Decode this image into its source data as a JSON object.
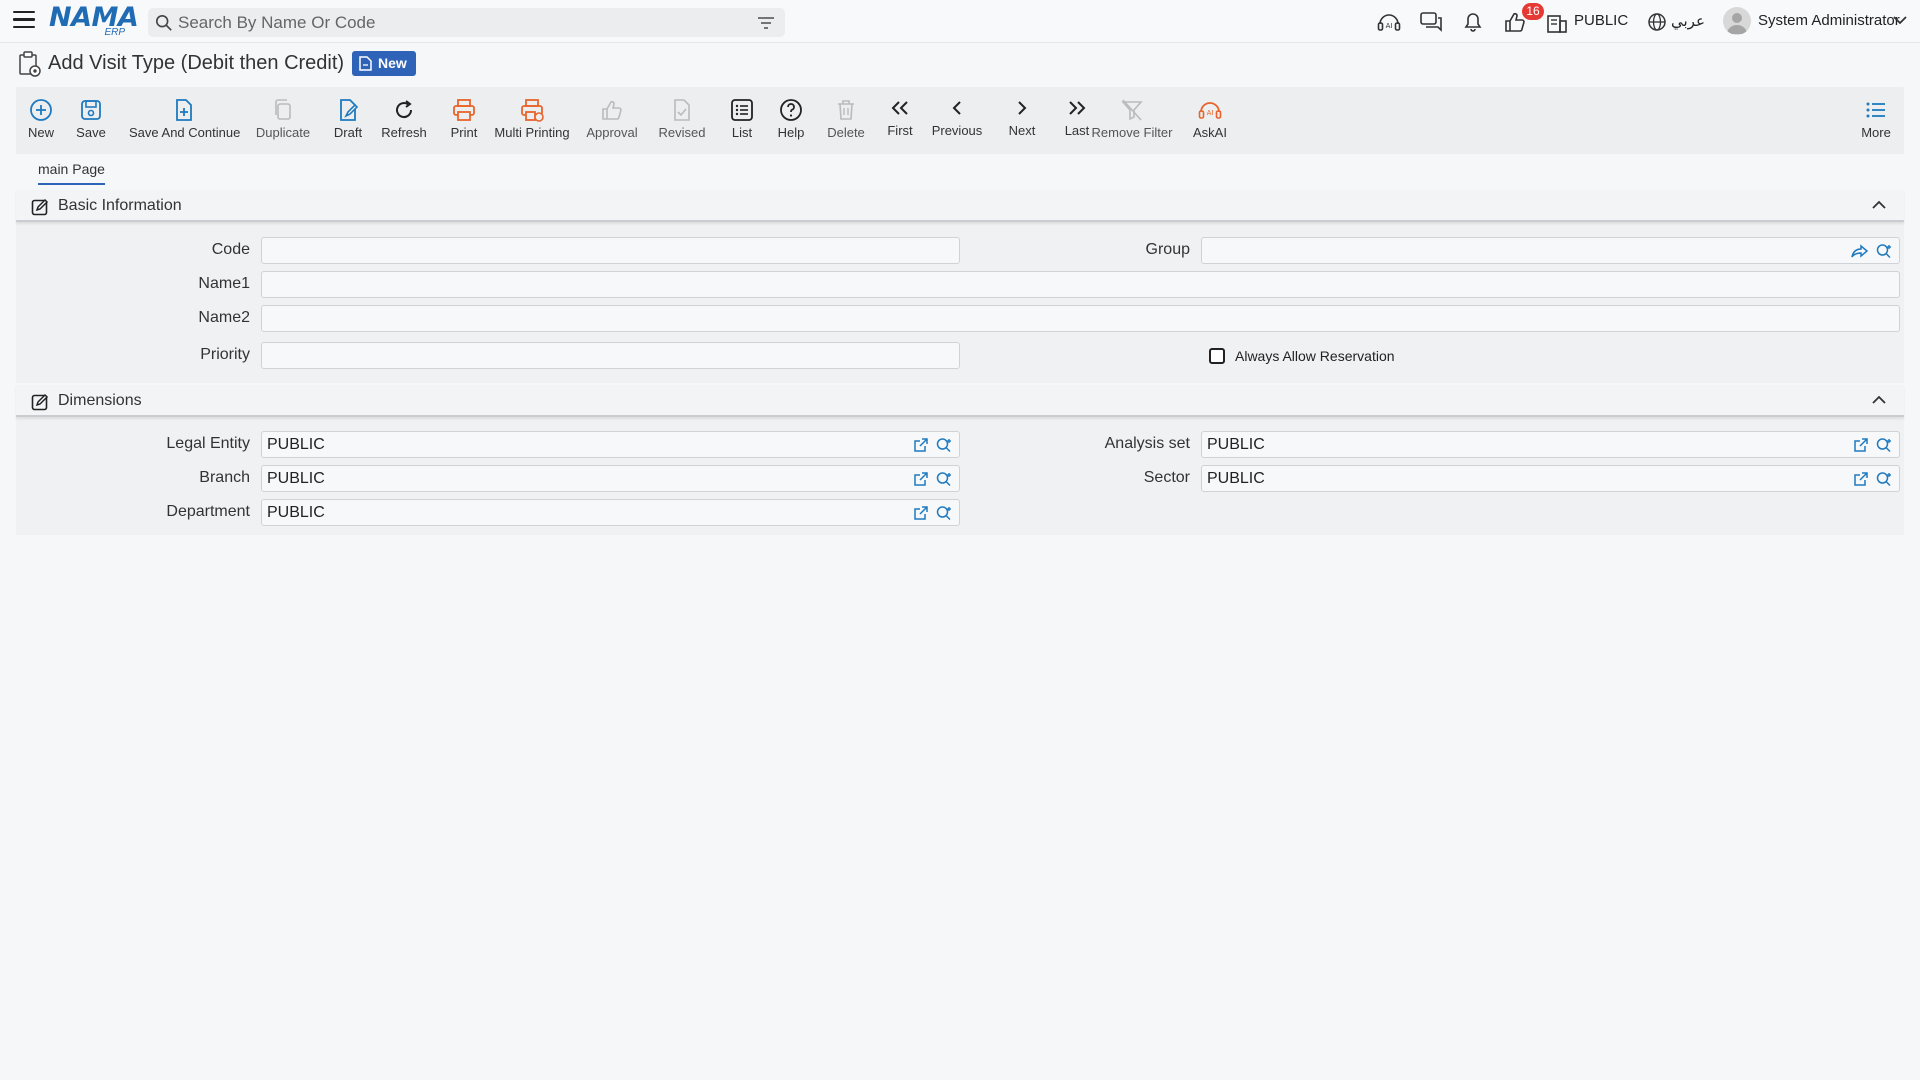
{
  "topbar": {
    "logo_text": "NAMA",
    "logo_sub": "ERP",
    "search_placeholder": "Search By Name Or Code",
    "notification_count": "16",
    "org_label": "PUBLIC",
    "language_label": "عربي",
    "user_name": "System Administrator"
  },
  "title": {
    "text": "Add Visit Type (Debit then Credit)",
    "badge": "New"
  },
  "toolbar": [
    {
      "name": "new",
      "label": "New",
      "icon": "plus-circle-icon"
    },
    {
      "name": "save",
      "label": "Save",
      "icon": "save-icon"
    },
    {
      "name": "save-and-continue",
      "label": "Save And Continue",
      "icon": "file-plus-icon"
    },
    {
      "name": "duplicate",
      "label": "Duplicate",
      "icon": "copy-icon"
    },
    {
      "name": "draft",
      "label": "Draft",
      "icon": "draft-edit-icon"
    },
    {
      "name": "refresh",
      "label": "Refresh",
      "icon": "refresh-icon"
    },
    {
      "name": "print",
      "label": "Print",
      "icon": "printer-icon"
    },
    {
      "name": "multi-printing",
      "label": "Multi Printing",
      "icon": "multi-printer-icon"
    },
    {
      "name": "approval",
      "label": "Approval",
      "icon": "thumbs-up-icon"
    },
    {
      "name": "revised",
      "label": "Revised",
      "icon": "revised-doc-icon"
    },
    {
      "name": "list",
      "label": "List",
      "icon": "list-icon"
    },
    {
      "name": "help",
      "label": "Help",
      "icon": "help-circle-icon"
    },
    {
      "name": "delete",
      "label": "Delete",
      "icon": "trash-icon"
    },
    {
      "name": "first",
      "label": "First",
      "icon": "double-chevron-left-icon"
    },
    {
      "name": "previous",
      "label": "Previous",
      "icon": "chevron-left-icon"
    },
    {
      "name": "next",
      "label": "Next",
      "icon": "chevron-right-icon"
    },
    {
      "name": "last",
      "label": "Last",
      "icon": "double-chevron-right-icon"
    },
    {
      "name": "remove-filter",
      "label": "Remove Filter",
      "icon": "filter-off-icon"
    },
    {
      "name": "askai",
      "label": "AskAI",
      "icon": "ai-headset-icon"
    },
    {
      "name": "more",
      "label": "More",
      "icon": "more-list-icon"
    }
  ],
  "tabs": {
    "main": "main Page"
  },
  "basic_info": {
    "title": "Basic Information",
    "code_label": "Code",
    "code_value": "",
    "group_label": "Group",
    "group_value": "",
    "name1_label": "Name1",
    "name1_value": "",
    "name2_label": "Name2",
    "name2_value": "",
    "priority_label": "Priority",
    "priority_value": "",
    "always_allow_label": "Always Allow Reservation",
    "always_allow_checked": false
  },
  "dimensions": {
    "title": "Dimensions",
    "legal_entity_label": "Legal Entity",
    "legal_entity_value": "PUBLIC",
    "analysis_set_label": "Analysis set",
    "analysis_set_value": "PUBLIC",
    "branch_label": "Branch",
    "branch_value": "PUBLIC",
    "sector_label": "Sector",
    "sector_value": "PUBLIC",
    "department_label": "Department",
    "department_value": "PUBLIC"
  },
  "colors": {
    "accent": "#2f63b8",
    "orange": "#e8642c",
    "icon_blue": "#1f7ac0",
    "badge_red": "#e53935"
  }
}
